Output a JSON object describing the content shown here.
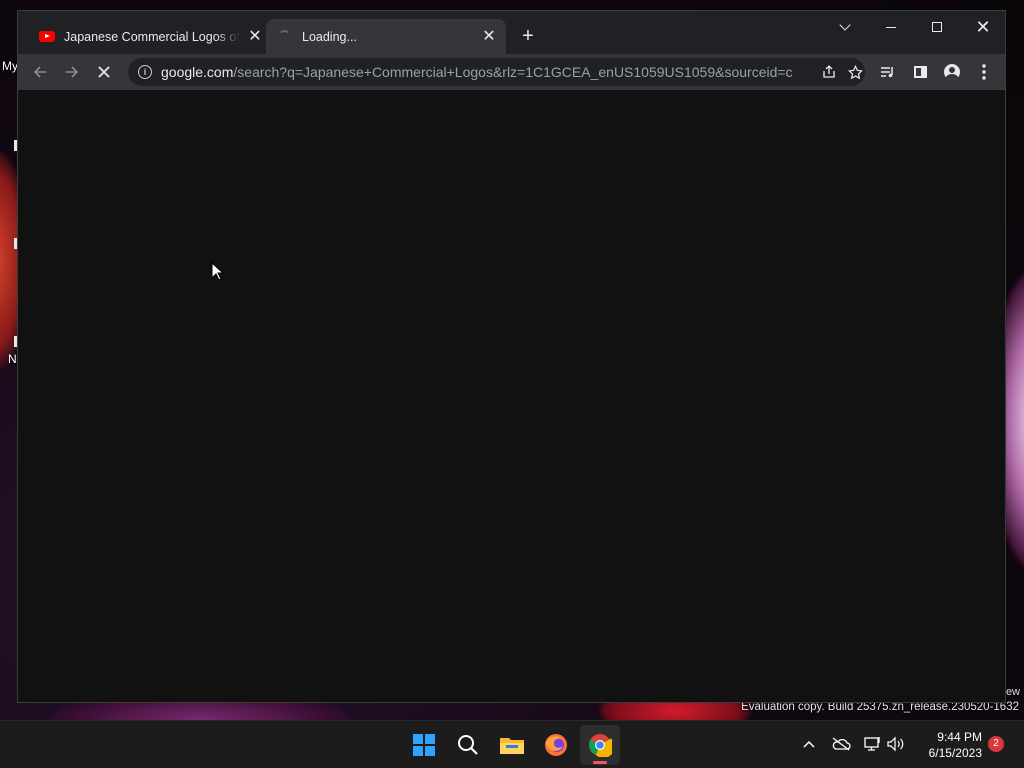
{
  "desktop": {
    "icon_labels": [
      "My",
      "N"
    ],
    "watermark_tail": "ew",
    "watermark": "Evaluation copy. Build 25375.zn_release.230520-1632"
  },
  "browser": {
    "tabs": [
      {
        "title": "Japanese Commercial Logos of th",
        "icon": "youtube-icon",
        "active": false
      },
      {
        "title": "Loading...",
        "icon": "loading-spinner-icon",
        "active": true
      }
    ],
    "new_tab_symbol": "+",
    "close_symbol": "✕",
    "address": {
      "host": "google.com",
      "path": "/search?q=Japanese+Commercial+Logos&rlz=1C1GCEA_enUS1059US1059&sourceid=ch..."
    },
    "page_state": "loading"
  },
  "taskbar": {
    "apps": [
      "start-icon",
      "search-icon",
      "file-explorer-icon",
      "firefox-icon",
      "chrome-icon"
    ],
    "clock": {
      "time": "9:44 PM",
      "date": "6/15/2023"
    },
    "notification_count": "2"
  },
  "colors": {
    "accent_blue": "#2fa3ff",
    "youtube_red": "#ff0000",
    "badge_red": "#d9363e",
    "chrome_indicator": "#f05a5a"
  }
}
